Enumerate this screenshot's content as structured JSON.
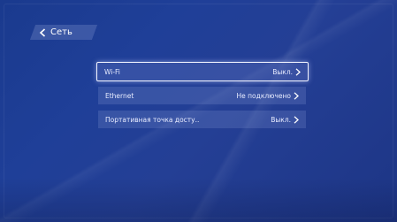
{
  "header": {
    "back_label": "Сеть"
  },
  "settings": [
    {
      "label": "Wi-Fi",
      "value": "Выкл."
    },
    {
      "label": "Ethernet",
      "value": "Не подключено"
    },
    {
      "label": "Портативная точка досту..",
      "value": "Выкл."
    }
  ],
  "icons": {
    "back": "chevron-left-icon",
    "row": "chevron-right-icon"
  },
  "colors": {
    "background": "#1f3f98",
    "focus_border": "#f2f4ff",
    "text": "#e8ecff"
  }
}
